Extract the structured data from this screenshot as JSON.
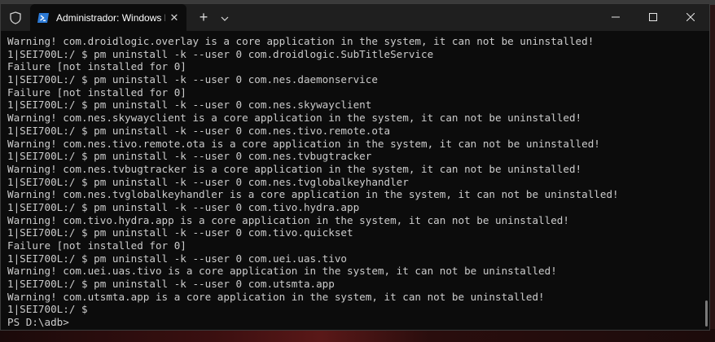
{
  "window": {
    "tab_title": "Administrador: Windows Pow",
    "new_tab_symbol": "+",
    "close_symbol": "✕",
    "icons": {
      "shield": "shield-icon",
      "tab": "powershell-icon",
      "dropdown": "chevron-down-icon",
      "minimize": "minimize-icon",
      "maximize": "maximize-icon",
      "close": "close-icon"
    }
  },
  "colors": {
    "console_bg": "#0c0c0c",
    "console_text": "#cccccc",
    "titlebar_bg": "#1f1f1f",
    "powershell_blue": "#2c7ad6"
  },
  "console": {
    "lines": [
      "Warning! com.droidlogic.overlay is a core application in the system, it can not be uninstalled!",
      "1|SEI700L:/ $ pm uninstall -k --user 0 com.droidlogic.SubTitleService",
      "Failure [not installed for 0]",
      "1|SEI700L:/ $ pm uninstall -k --user 0 com.nes.daemonservice",
      "Failure [not installed for 0]",
      "1|SEI700L:/ $ pm uninstall -k --user 0 com.nes.skywayclient",
      "Warning! com.nes.skywayclient is a core application in the system, it can not be uninstalled!",
      "1|SEI700L:/ $ pm uninstall -k --user 0 com.nes.tivo.remote.ota",
      "Warning! com.nes.tivo.remote.ota is a core application in the system, it can not be uninstalled!",
      "1|SEI700L:/ $ pm uninstall -k --user 0 com.nes.tvbugtracker",
      "Warning! com.nes.tvbugtracker is a core application in the system, it can not be uninstalled!",
      "1|SEI700L:/ $ pm uninstall -k --user 0 com.nes.tvglobalkeyhandler",
      "Warning! com.nes.tvglobalkeyhandler is a core application in the system, it can not be uninstalled!",
      "1|SEI700L:/ $ pm uninstall -k --user 0 com.tivo.hydra.app",
      "Warning! com.tivo.hydra.app is a core application in the system, it can not be uninstalled!",
      "1|SEI700L:/ $ pm uninstall -k --user 0 com.tivo.quickset",
      "Failure [not installed for 0]",
      "1|SEI700L:/ $ pm uninstall -k --user 0 com.uei.uas.tivo",
      "Warning! com.uei.uas.tivo is a core application in the system, it can not be uninstalled!",
      "1|SEI700L:/ $ pm uninstall -k --user 0 com.utsmta.app",
      "Warning! com.utsmta.app is a core application in the system, it can not be uninstalled!",
      "1|SEI700L:/ $",
      "PS D:\\adb>"
    ]
  }
}
